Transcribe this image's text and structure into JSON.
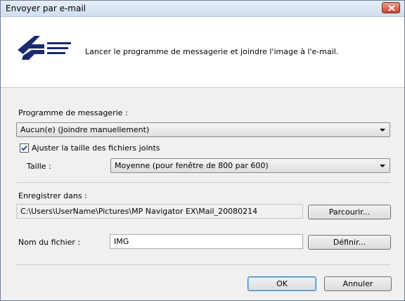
{
  "window": {
    "title": "Envoyer par e-mail"
  },
  "header": {
    "description": "Lancer le programme de messagerie et joindre l'image à l'e-mail."
  },
  "mail_program": {
    "label": "Programme de messagerie :",
    "selected": "Aucun(e) (Joindre manuellement)"
  },
  "resize": {
    "checkbox_label": "Ajuster la taille des fichiers joints",
    "checked": true,
    "size_label": "Taille :",
    "size_selected": "Moyenne (pour fenêtre de 800 par 600)"
  },
  "save": {
    "label": "Enregistrer dans :",
    "path": "C:\\Users\\UserName\\Pictures\\MP Navigator EX\\Mail_20080214",
    "browse_button": "Parcourir..."
  },
  "file": {
    "label": "Nom du fichier :",
    "value": "IMG",
    "define_button": "Définir..."
  },
  "footer": {
    "ok_button": "OK",
    "cancel_button": "Annuler"
  },
  "colors": {
    "close_button": "#c6462e",
    "logo": "#1a2a6e",
    "default_button_border": "#3c7fb1"
  },
  "icons": {
    "logo": "mail-plane-logo-icon",
    "close": "close-icon",
    "check": "check-icon",
    "dropdown": "chevron-down-icon"
  }
}
